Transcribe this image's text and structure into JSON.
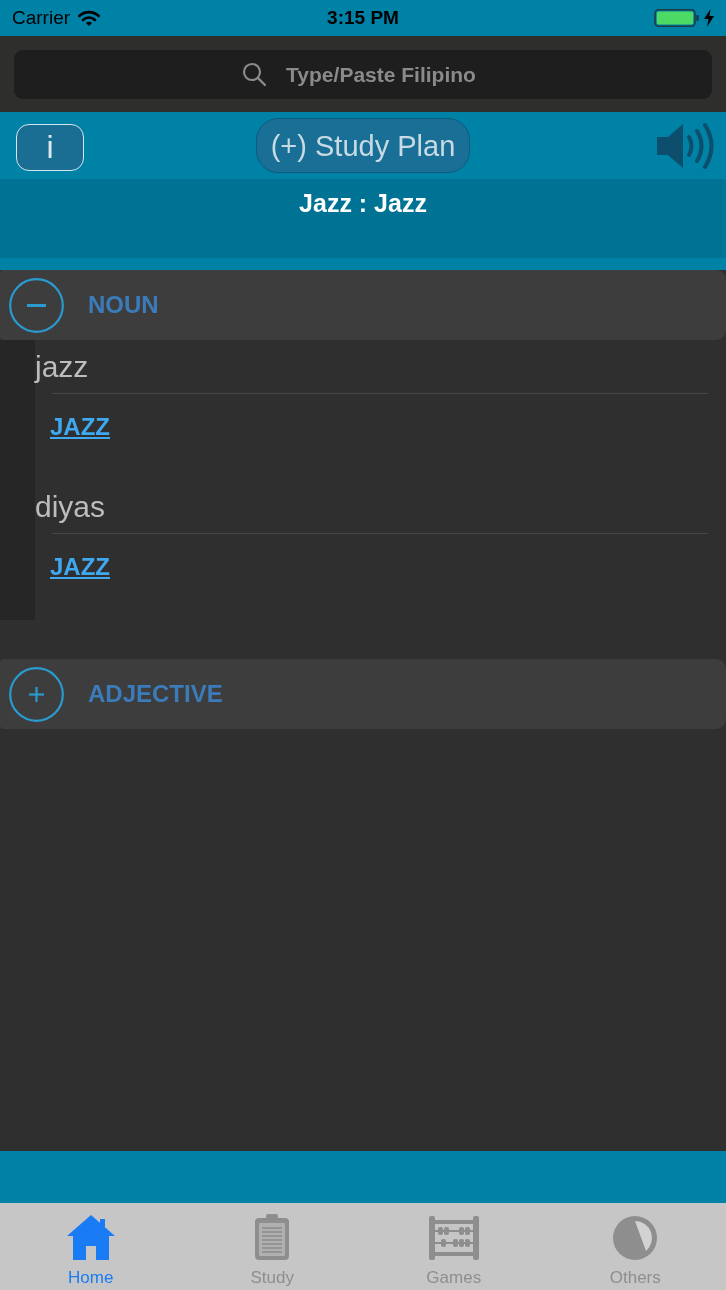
{
  "status_bar": {
    "carrier": "Carrier",
    "time": "3:15 PM"
  },
  "search": {
    "placeholder": "Type/Paste Filipino"
  },
  "toolbar": {
    "info_button": "i",
    "study_plan_button": "(+) Study Plan"
  },
  "title": "Jazz : Jazz",
  "sections": [
    {
      "label": "NOUN",
      "expanded": true,
      "entries": [
        {
          "word": "jazz",
          "translations": [
            "JAZZ"
          ]
        },
        {
          "word": "diyas",
          "translations": [
            "JAZZ"
          ]
        }
      ]
    },
    {
      "label": "ADJECTIVE",
      "expanded": false
    }
  ],
  "tab_bar": {
    "tabs": [
      {
        "label": "Home",
        "selected": true
      },
      {
        "label": "Study",
        "selected": false
      },
      {
        "label": "Games",
        "selected": false
      },
      {
        "label": "Others",
        "selected": false
      }
    ]
  }
}
